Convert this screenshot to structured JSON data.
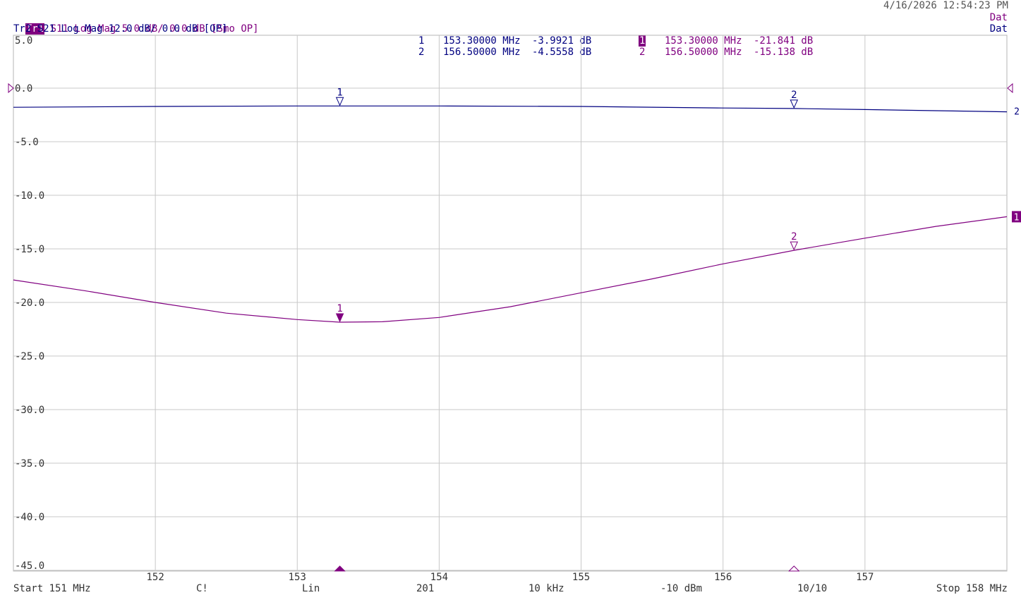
{
  "header": {
    "tr1_tag": "Tr1",
    "tr1_text": "S11 Log Mag 5.0 dB/ 0.0 dB [Smo OP]",
    "tr2_text": "Tr2 S21 Log Mag 12.0 dB/ 0.0 dB [OP]",
    "datetime": "4/16/2026 12:54:23 PM",
    "dat1": "Dat",
    "dat2": "Dat"
  },
  "markers_table": {
    "tr2": [
      {
        "num": "1",
        "freq": "153.30000 MHz",
        "value": "-3.9921 dB"
      },
      {
        "num": "2",
        "freq": "156.50000 MHz",
        "value": "-4.5558 dB"
      }
    ],
    "tr1": [
      {
        "num": "1",
        "freq": "153.30000 MHz",
        "value": "-21.841 dB"
      },
      {
        "num": "2",
        "freq": "156.50000 MHz",
        "value": "-15.138 dB"
      }
    ]
  },
  "footer": {
    "start": "Start 151 MHz",
    "cal": "C!",
    "sweep": "Lin",
    "points": "201",
    "ifbw": "10 kHz",
    "power": "-10 dBm",
    "avg": "10/10",
    "stop": "Stop 158 MHz"
  },
  "colors": {
    "trace1": "#800080",
    "trace2": "#000080",
    "grid": "#c8c8c8",
    "text": "#333333"
  },
  "chart_data": {
    "type": "line",
    "xlim": [
      151,
      158
    ],
    "ylim": [
      -45,
      5
    ],
    "x_ticks": [
      "152",
      "153",
      "154",
      "155",
      "156",
      "157"
    ],
    "y_ticks": [
      "5.0",
      "0.0",
      "-5.0",
      "-10.0",
      "-15.0",
      "-20.0",
      "-25.0",
      "-30.0",
      "-35.0",
      "-40.0",
      "-45.0"
    ],
    "grid": true,
    "series": [
      {
        "name": "S11",
        "trace": "Tr1",
        "color": "#800080",
        "end_label": "1",
        "x": [
          151.0,
          151.5,
          152.0,
          152.5,
          153.0,
          153.3,
          153.6,
          154.0,
          154.5,
          155.0,
          155.5,
          156.0,
          156.5,
          157.0,
          157.5,
          158.0
        ],
        "y": [
          -17.9,
          -18.9,
          -20.0,
          -21.0,
          -21.6,
          -21.84,
          -21.8,
          -21.4,
          -20.4,
          -19.1,
          -17.8,
          -16.4,
          -15.14,
          -14.0,
          -12.9,
          -12.0
        ]
      },
      {
        "name": "S21",
        "trace": "Tr2",
        "color": "#000080",
        "end_label": "2",
        "scale_db_per_div": 12,
        "x": [
          151.0,
          152.0,
          153.0,
          153.3,
          154.0,
          155.0,
          156.0,
          156.5,
          157.0,
          158.0
        ],
        "y": [
          -4.3,
          -4.1,
          -4.0,
          -3.99,
          -4.0,
          -4.1,
          -4.45,
          -4.56,
          -4.8,
          -5.3
        ]
      }
    ],
    "markers": [
      {
        "series": 0,
        "label": "1",
        "x": 153.3,
        "y": -21.841,
        "active": true
      },
      {
        "series": 0,
        "label": "2",
        "x": 156.5,
        "y": -15.138,
        "active": false
      },
      {
        "series": 1,
        "label": "1",
        "x": 153.3,
        "y": -3.9921,
        "active": false
      },
      {
        "series": 1,
        "label": "2",
        "x": 156.5,
        "y": -4.5558,
        "active": false
      }
    ]
  }
}
